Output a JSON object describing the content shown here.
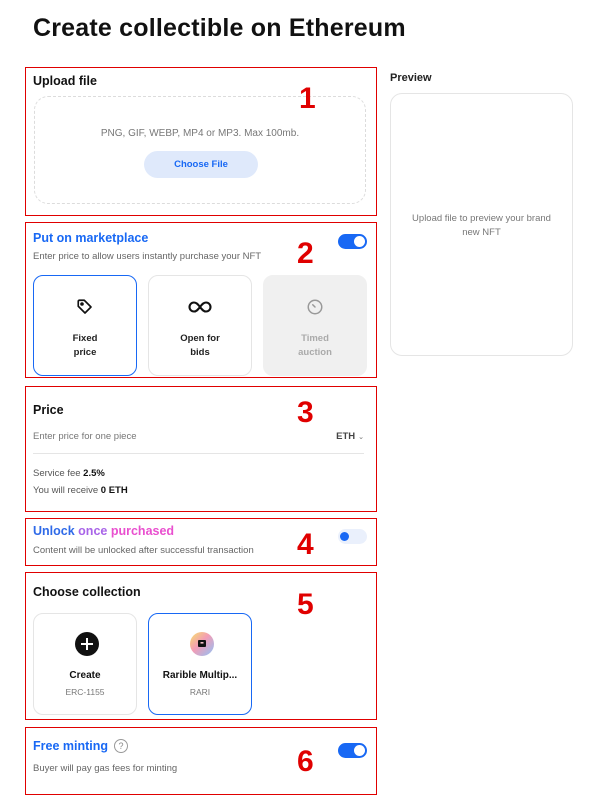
{
  "page": {
    "title": "Create collectible on Ethereum"
  },
  "annotations": [
    "1",
    "2",
    "3",
    "4",
    "5",
    "6"
  ],
  "upload": {
    "title": "Upload file",
    "hint": "PNG, GIF, WEBP, MP4 or MP3. Max 100mb.",
    "button": "Choose File"
  },
  "preview": {
    "title": "Preview",
    "placeholder": "Upload file to preview your brand new NFT"
  },
  "marketplace": {
    "title": "Put on marketplace",
    "subtitle": "Enter price to allow users instantly purchase your NFT",
    "enabled": true,
    "options": [
      {
        "line1": "Fixed",
        "line2": "price",
        "icon": "tag-icon",
        "state": "selected"
      },
      {
        "line1": "Open for",
        "line2": "bids",
        "icon": "infinity-icon",
        "state": "normal"
      },
      {
        "line1": "Timed",
        "line2": "auction",
        "icon": "clock-icon",
        "state": "disabled"
      }
    ]
  },
  "price": {
    "title": "Price",
    "placeholder": "Enter price for one piece",
    "currency": "ETH",
    "fee_label": "Service fee",
    "fee_value": "2.5%",
    "receive_label": "You will receive",
    "receive_value": "0 ETH"
  },
  "unlock": {
    "title_part1": "Unlock",
    "title_part2": "once",
    "title_part3": "purchased",
    "subtitle": "Content will be unlocked after successful transaction",
    "enabled": false
  },
  "collection": {
    "title": "Choose collection",
    "items": [
      {
        "name": "Create",
        "sub": "ERC-1155",
        "icon": "plus-circle-icon",
        "state": "normal"
      },
      {
        "name": "Rarible Multip...",
        "sub": "RARI",
        "icon": "rarible-logo-icon",
        "state": "selected"
      }
    ]
  },
  "free_minting": {
    "title": "Free minting",
    "help": "?",
    "subtitle": "Buyer will pay gas fees for minting",
    "enabled": true
  },
  "colors": {
    "accent": "#1868f4",
    "annotation": "#e00000"
  }
}
